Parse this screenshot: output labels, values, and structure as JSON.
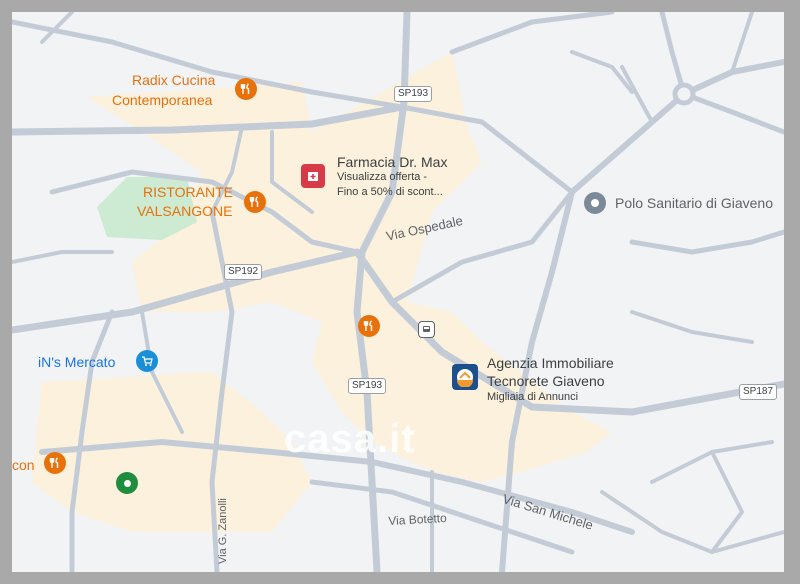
{
  "map": {
    "pois": {
      "radix_cucina": "Radix Cucina\nContemporanea",
      "radix_line1": "Radix Cucina",
      "radix_line2": "Contemporanea",
      "ristorante_line1": "RISTORANTE",
      "ristorante_line2": "VALSANGONE",
      "farmacia_name": "Farmacia Dr. Max",
      "farmacia_sub1": "Visualizza offerta -",
      "farmacia_sub2": "Fino a 50% di scont...",
      "polo_sanitario": "Polo Sanitario di Giaveno",
      "mercato": "iN's Mercato",
      "agenzia_line1": "Agenzia Immobiliare",
      "agenzia_line2": "Tecnorete Giaveno",
      "agenzia_sub": "Migliaia di Annunci",
      "partial_left": "con"
    },
    "roads": {
      "sp193_top": "SP193",
      "sp192": "SP192",
      "sp193_bottom": "SP193",
      "sp187": "SP187",
      "via_ospedale": "Via Ospedale",
      "via_san_michele": "Via San Michele",
      "via_botetto": "Via Botetto",
      "via_zanolli": "Via G. Zanolli"
    },
    "watermark": "casa.it",
    "colors": {
      "road": "#c3ccd6",
      "urban": "#fbf1dc",
      "park": "#cdebd2",
      "food": "#e8710a",
      "pharmacy": "#d93a48",
      "medical": "#7b8a99",
      "shop": "#1a8fd8",
      "green_pin": "#1e8e3e"
    }
  }
}
